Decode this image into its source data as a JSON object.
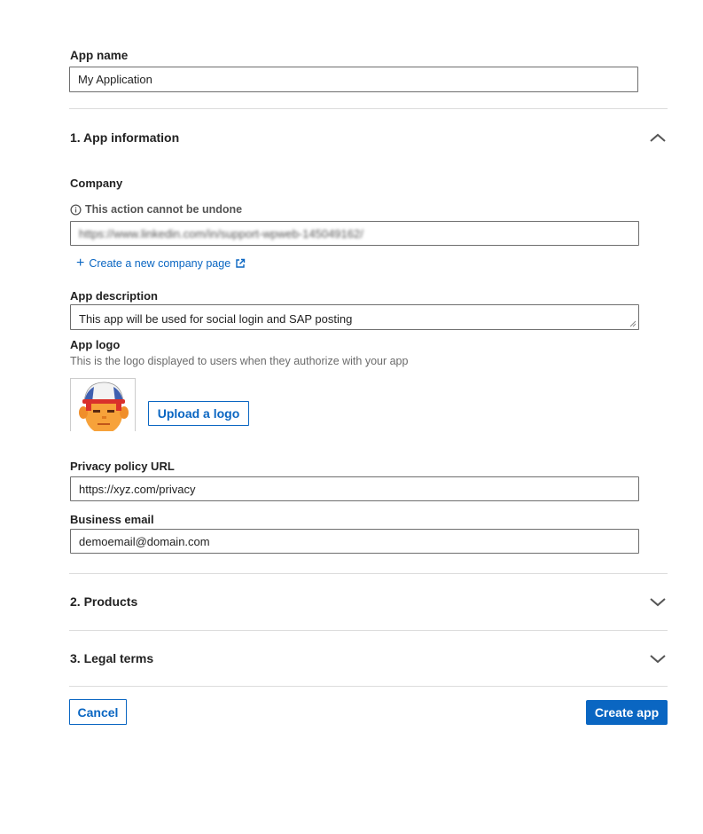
{
  "app_name": {
    "label": "App name",
    "value": "My Application"
  },
  "app_information": {
    "title": "1. App information",
    "company": {
      "label": "Company",
      "notice": "This action cannot be undone",
      "value": "https://www.linkedin.com/in/support-wpweb-145049162/",
      "create_link": "Create a new company page"
    },
    "description": {
      "label": "App description",
      "value": "This app will be used for social login and SAP posting"
    },
    "logo": {
      "label": "App logo",
      "hint": "This is the logo displayed to users when they authorize with your app",
      "upload_label": "Upload a logo"
    },
    "privacy": {
      "label": "Privacy policy URL",
      "value": "https://xyz.com/privacy"
    },
    "email": {
      "label": "Business email",
      "value": "demoemail@domain.com"
    }
  },
  "products": {
    "title": "2. Products"
  },
  "legal_terms": {
    "title": "3. Legal terms"
  },
  "actions": {
    "cancel_label": "Cancel",
    "create_label": "Create app"
  },
  "colors": {
    "accent": "#0a66c2",
    "border": "#6e6e6e",
    "divider": "#dcdcdc"
  },
  "icons": {
    "notice": "info-circle-icon",
    "create_link": "plus-icon",
    "external": "external-link-icon",
    "expanded": "chevron-up-icon",
    "collapsed": "chevron-down-icon"
  }
}
